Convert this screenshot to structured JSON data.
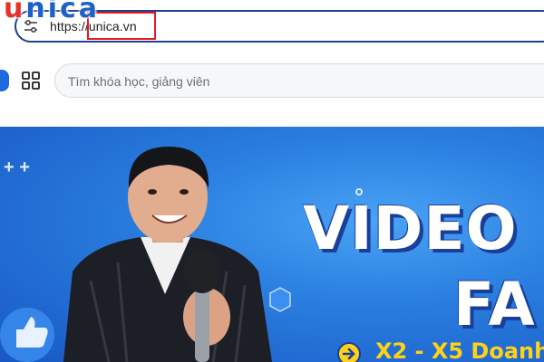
{
  "browser": {
    "url_scheme": "https://",
    "url_host": "unica.vn",
    "site_info_icon": "tune-icon"
  },
  "logo": {
    "text_first": "u",
    "text_rest": "nica"
  },
  "header": {
    "apps_icon": "grid-icon",
    "search": {
      "placeholder": "Tìm khóa học, giảng viên",
      "value": ""
    }
  },
  "banner": {
    "headline_1": "VIDEO",
    "headline_2": "FA",
    "subline": "X2 - X5 Doanh"
  },
  "colors": {
    "address_border": "#1f3f8f",
    "highlight_box": "#e01b24",
    "banner_blue": "#2a7fe0",
    "subline_yellow": "#ffd21a",
    "logo_red": "#e3312d",
    "logo_blue": "#1e60c8"
  }
}
